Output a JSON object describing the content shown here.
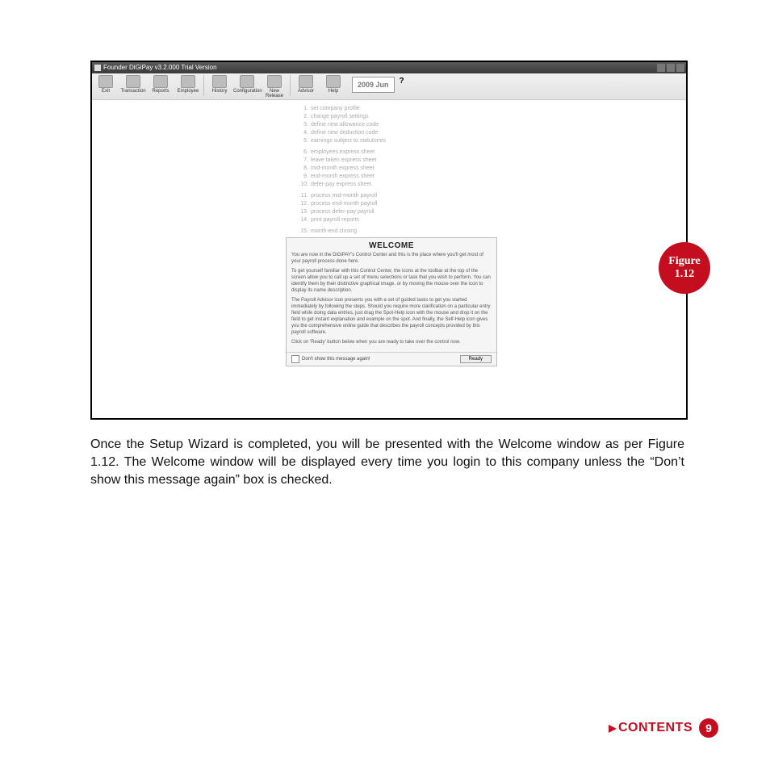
{
  "window_title": "Founder DiGiPay v3.2.000 Trial Version",
  "toolbar": {
    "buttons": [
      "Exit",
      "Transaction",
      "Reports",
      "Employee",
      "History",
      "Configuration",
      "New Release",
      "Advisor",
      "Help"
    ],
    "date": "2009 Jun",
    "help_cursor": "?"
  },
  "tasks": {
    "group1": [
      {
        "n": "1.",
        "t": "set company profile"
      },
      {
        "n": "2.",
        "t": "change payroll settings"
      },
      {
        "n": "3.",
        "t": "define new allowance code"
      },
      {
        "n": "4.",
        "t": "define new deduction code"
      },
      {
        "n": "5.",
        "t": "earnings subject to statutories"
      }
    ],
    "group2": [
      {
        "n": "6.",
        "t": "employees express sheet"
      },
      {
        "n": "7.",
        "t": "leave taken express sheet"
      },
      {
        "n": "8.",
        "t": "mid-month express sheet"
      },
      {
        "n": "9.",
        "t": "end-month express sheet"
      },
      {
        "n": "10.",
        "t": "defer-pay express sheet"
      }
    ],
    "group3": [
      {
        "n": "11.",
        "t": "process mid-month payroll"
      },
      {
        "n": "12.",
        "t": "process end-month payroll"
      },
      {
        "n": "13.",
        "t": "process defer-pay payroll"
      },
      {
        "n": "14.",
        "t": "print payroll reports"
      }
    ],
    "group4": [
      {
        "n": "15.",
        "t": "month-end closing"
      }
    ]
  },
  "modal": {
    "title": "WELCOME",
    "p1": "You are now in the DiGiPAY's Control Center and this is the place where you'll get most of your payroll process done here.",
    "p2": "To get yourself familiar with this Control Center, the icons at the toolbar at the top of the screen allow you to call up a set of menu selections or task that you wish to perform. You can identify them by their distinctive graphical image, or by moving the mouse over the icon to display its name description.",
    "p3": "The Payroll Advisor icon presents you with a set of guided tasks to get you started immediately by following the steps. Should you require more clarification on a particular entry field while doing data entries, just drag the Spot-Help icon with the mouse and drop it on the field to get instant explanation and example on the spot. And finally, the Self-Help icon gives you the comprehensive online guide that describes the payroll concepts provided by this payroll software.",
    "p4": "Click on 'Ready' button below when you are ready to take over the control now.",
    "checkbox_label": "Don't show this message again!",
    "ready": "Ready"
  },
  "badge": {
    "line1": "Figure",
    "line2": "1.12"
  },
  "body_paragraph": "Once the Setup Wizard is completed, you will be presented with the Welcome window as per Figure 1.12. The Welcome window will be displayed every time you login to this company unless the “Don’t show this message again” box is checked.",
  "footer": {
    "contents": "CONTENTS",
    "page": "9"
  }
}
